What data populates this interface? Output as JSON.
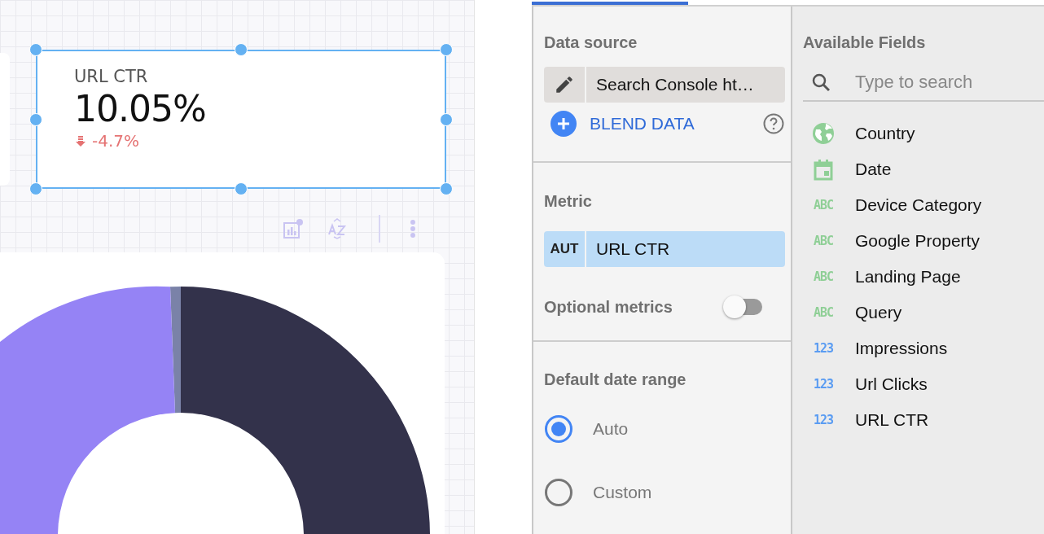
{
  "scorecard": {
    "label": "URL CTR",
    "value": "10.05%",
    "delta": {
      "text": "-4.7%",
      "kind": "down"
    },
    "selected": true
  },
  "data_source": {
    "title": "Data source",
    "name": "Search Console ht…",
    "blend_label": "BLEND DATA"
  },
  "metric": {
    "title": "Metric",
    "type_badge": "AUT",
    "field": "URL CTR",
    "selected": true
  },
  "optional_metrics": {
    "label": "Optional metrics",
    "on": false
  },
  "date_range": {
    "title": "Default date range",
    "options": [
      {
        "label": "Auto",
        "selected": true
      },
      {
        "label": "Custom",
        "selected": false
      }
    ]
  },
  "available_fields": {
    "title": "Available Fields",
    "search": {
      "placeholder": "Type to search"
    },
    "fields": [
      {
        "name": "Country",
        "kind": "geo"
      },
      {
        "name": "Date",
        "kind": "date"
      },
      {
        "name": "Device Category",
        "kind": "text",
        "type_label": "ABC"
      },
      {
        "name": "Google Property",
        "kind": "text",
        "type_label": "ABC"
      },
      {
        "name": "Landing Page",
        "kind": "text",
        "type_label": "ABC"
      },
      {
        "name": "Query",
        "kind": "text",
        "type_label": "ABC"
      },
      {
        "name": "Impressions",
        "kind": "number",
        "type_label": "123"
      },
      {
        "name": "Url Clicks",
        "kind": "number",
        "type_label": "123"
      },
      {
        "name": "URL CTR",
        "kind": "number",
        "type_label": "123"
      }
    ]
  }
}
